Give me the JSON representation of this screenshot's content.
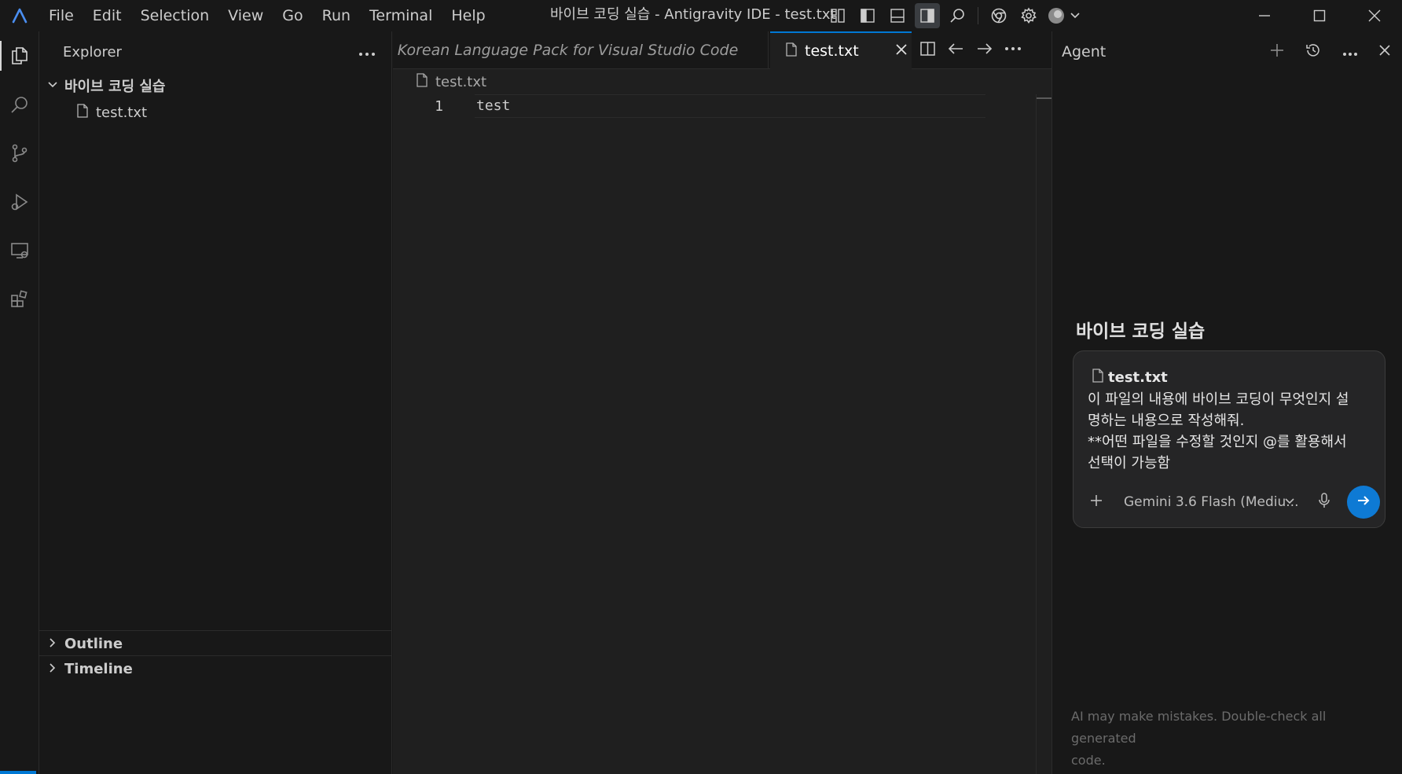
{
  "app": {
    "window_title": "바이브 코딩 실습 - Antigravity IDE - test.txt",
    "menu": [
      "File",
      "Edit",
      "Selection",
      "View",
      "Go",
      "Run",
      "Terminal",
      "Help"
    ]
  },
  "sidebar": {
    "title": "Explorer",
    "folder": "바이브 코딩 실습",
    "files": [
      "test.txt"
    ],
    "sections": [
      "Outline",
      "Timeline"
    ]
  },
  "editor": {
    "tabs": [
      {
        "label": "Extension: Korean Language Pack for Visual Studio Code",
        "active": false
      },
      {
        "label": "test.txt",
        "active": true
      }
    ],
    "breadcrumb": "test.txt",
    "lines": [
      {
        "number": "1",
        "text": "test"
      }
    ]
  },
  "agent": {
    "title": "Agent",
    "project": "바이브 코딩 실습",
    "attached_file": "test.txt",
    "message_lines": [
      "이 파일의 내용에 바이브 코딩이 무엇인지 설",
      "명하는 내용으로 작성해줘.",
      "**어떤 파일을 수정할 것인지 @를 활용해서",
      "선택이 가능함"
    ],
    "model": "Gemini 3.6 Flash (Mediu...",
    "disclaimer_lines": [
      "AI may make mistakes. Double-check all generated",
      "code."
    ]
  },
  "colors": {
    "accent": "#0078d4",
    "send_button": "#0e7ad4",
    "background": "#181818",
    "editor_bg": "#1f1f1f"
  }
}
